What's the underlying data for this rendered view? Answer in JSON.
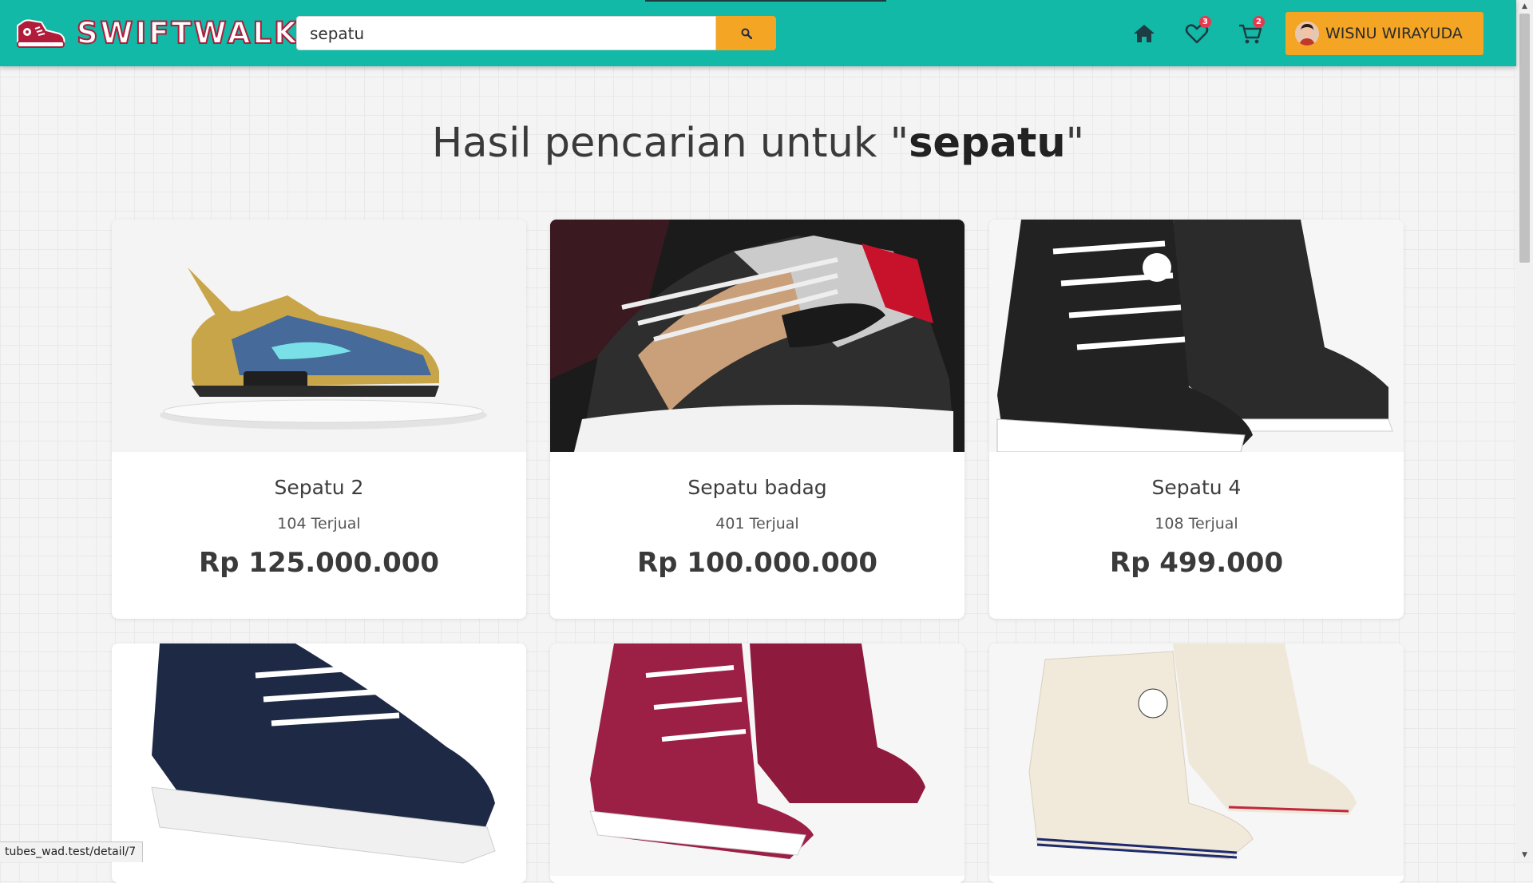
{
  "brand": {
    "name": "SWIFTWALK",
    "color_primary": "#11b9a6",
    "color_accent": "#f5a524",
    "color_logo": "#b01c3a"
  },
  "search": {
    "value": "sepatu",
    "button_icon": "search-icon"
  },
  "nav": {
    "home_icon": "home-icon",
    "wishlist": {
      "icon": "heart-icon",
      "count": "3"
    },
    "cart": {
      "icon": "cart-icon",
      "count": "2"
    },
    "user": {
      "name": "WISNU WIRAYUDA",
      "avatar_icon": "avatar"
    }
  },
  "heading": {
    "prefix": "Hasil pencarian untuk \"",
    "query": "sepatu",
    "suffix": "\""
  },
  "products": [
    {
      "name": "Sepatu 2",
      "sold": "104 Terjual",
      "price": "Rp 125.000.000"
    },
    {
      "name": "Sepatu badag",
      "sold": "401 Terjual",
      "price": "Rp 100.000.000"
    },
    {
      "name": "Sepatu 4",
      "sold": "108 Terjual",
      "price": "Rp 499.000"
    },
    {
      "name": "",
      "sold": "",
      "price": ""
    },
    {
      "name": "",
      "sold": "",
      "price": ""
    },
    {
      "name": "",
      "sold": "",
      "price": ""
    }
  ],
  "status_bar": {
    "url": "tubes_wad.test/detail/7"
  }
}
